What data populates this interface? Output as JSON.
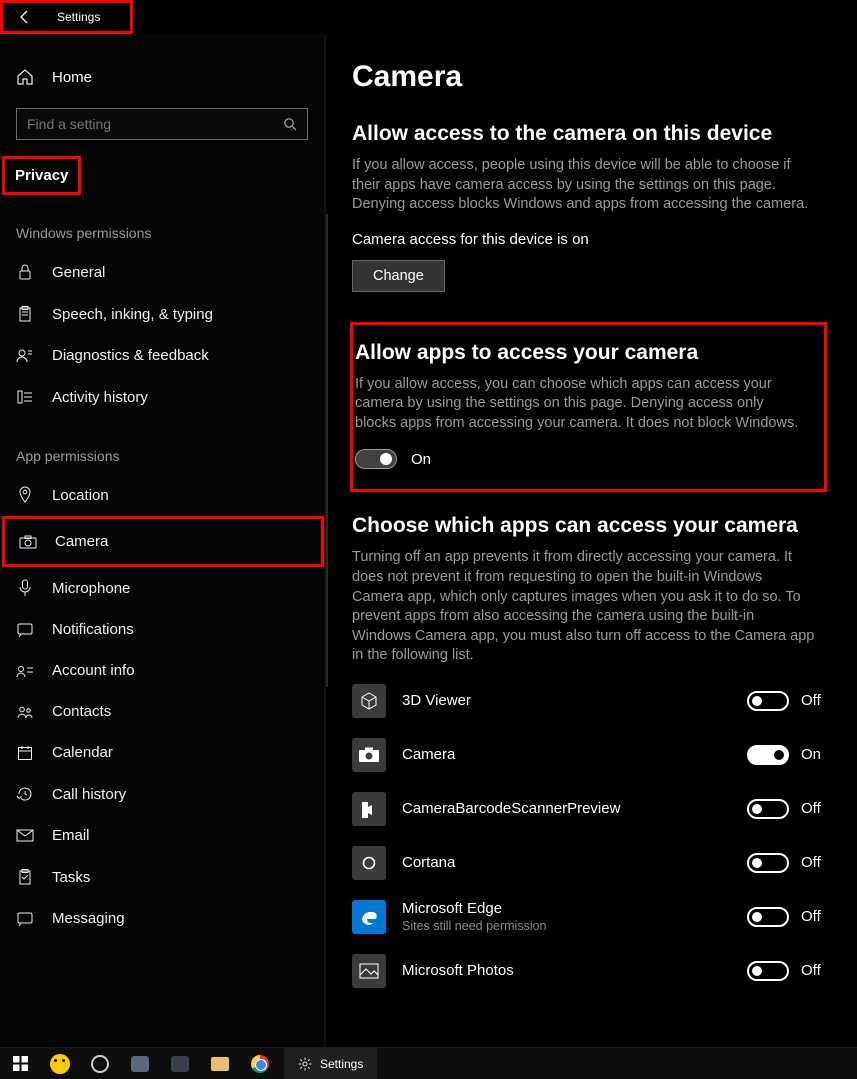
{
  "header": {
    "title": "Settings"
  },
  "sidebar": {
    "home": "Home",
    "search_placeholder": "Find a setting",
    "privacy_label": "Privacy",
    "group1_title": "Windows permissions",
    "group1": [
      {
        "label": "General"
      },
      {
        "label": "Speech, inking, & typing"
      },
      {
        "label": "Diagnostics & feedback"
      },
      {
        "label": "Activity history"
      }
    ],
    "group2_title": "App permissions",
    "group2": [
      {
        "label": "Location"
      },
      {
        "label": "Camera"
      },
      {
        "label": "Microphone"
      },
      {
        "label": "Notifications"
      },
      {
        "label": "Account info"
      },
      {
        "label": "Contacts"
      },
      {
        "label": "Calendar"
      },
      {
        "label": "Call history"
      },
      {
        "label": "Email"
      },
      {
        "label": "Tasks"
      },
      {
        "label": "Messaging"
      }
    ]
  },
  "main": {
    "title": "Camera",
    "s1_title": "Allow access to the camera on this device",
    "s1_desc": "If you allow access, people using this device will be able to choose if their apps have camera access by using the settings on this page. Denying access blocks Windows and apps from accessing the camera.",
    "s1_status": "Camera access for this device is on",
    "s1_button": "Change",
    "s2_title": "Allow apps to access your camera",
    "s2_desc": "If you allow access, you can choose which apps can access your camera by using the settings on this page. Denying access only blocks apps from accessing your camera. It does not block Windows.",
    "s2_toggle_label": "On",
    "s3_title": "Choose which apps can access your camera",
    "s3_desc": "Turning off an app prevents it from directly accessing your camera. It does not prevent it from requesting to open the built-in Windows Camera app, which only captures images when you ask it to do so. To prevent apps from also accessing the camera using the built-in Windows Camera app, you must also turn off access to the Camera app in the following list.",
    "apps": [
      {
        "name": "3D Viewer",
        "state": "Off"
      },
      {
        "name": "Camera",
        "state": "On"
      },
      {
        "name": "CameraBarcodeScannerPreview",
        "state": "Off"
      },
      {
        "name": "Cortana",
        "state": "Off"
      },
      {
        "name": "Microsoft Edge",
        "sub": "Sites still need permission",
        "state": "Off"
      },
      {
        "name": "Microsoft Photos",
        "state": "Off"
      }
    ]
  },
  "taskbar": {
    "settings": "Settings"
  }
}
